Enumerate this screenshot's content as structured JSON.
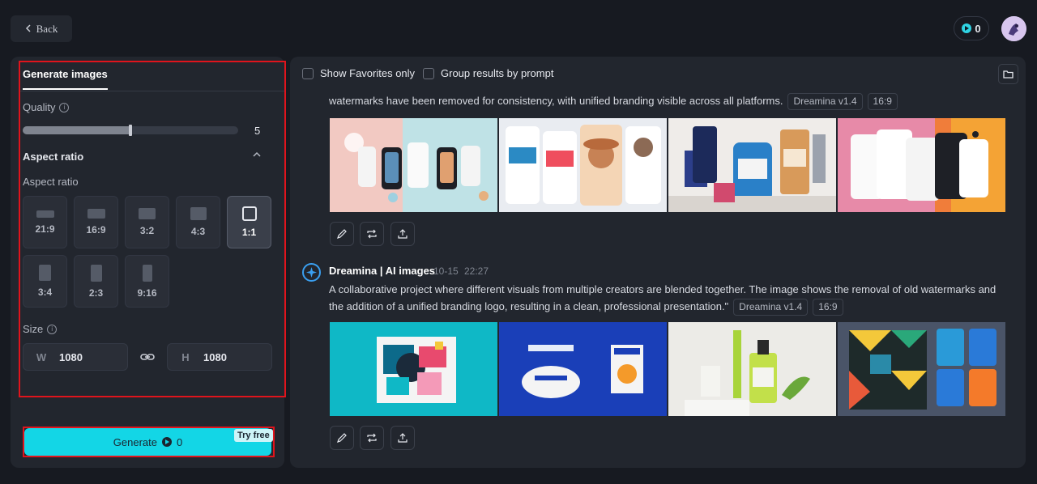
{
  "header": {
    "back_label": "Back",
    "credits": "0"
  },
  "left_panel": {
    "tab_label": "Generate images",
    "quality_label": "Quality",
    "quality_value": "5",
    "quality_fraction": 0.5,
    "aspect_section_title": "Aspect ratio",
    "aspect_label": "Aspect ratio",
    "ratios": [
      "21:9",
      "16:9",
      "3:2",
      "4:3",
      "1:1",
      "3:4",
      "2:3",
      "9:16"
    ],
    "selected_ratio": "1:1",
    "size_label": "Size",
    "width_axis": "W",
    "width_value": "1080",
    "height_axis": "H",
    "height_value": "1080",
    "generate_label": "Generate",
    "generate_credits": "0",
    "try_free_label": "Try free"
  },
  "results": {
    "show_favorites_label": "Show Favorites only",
    "group_by_prompt_label": "Group results by prompt",
    "item1": {
      "prompt": "watermarks have been removed for consistency, with unified branding visible across all platforms.",
      "model": "Dreamina v1.4",
      "ratio": "16:9"
    },
    "item2": {
      "author": "Dreamina | AI images",
      "date": "10-15",
      "time": "22:27",
      "prompt": "A collaborative project where different visuals from multiple creators are blended together. The image shows the removal of old watermarks and the addition of a unified branding logo, resulting in a clean, professional presentation.\"",
      "model": "Dreamina v1.4",
      "ratio": "16:9"
    }
  },
  "colors": {
    "accent": "#13d6e6",
    "highlight": "#e0141c",
    "panel": "#22262e",
    "background": "#171a21"
  }
}
